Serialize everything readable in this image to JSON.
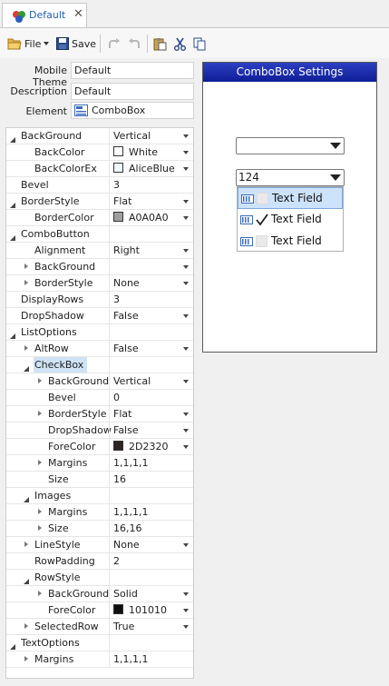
{
  "tab": {
    "label": "Default"
  },
  "toolbar": {
    "file_label": "File",
    "save_label": "Save"
  },
  "form": {
    "mobile_theme_label": "Mobile Theme",
    "mobile_theme_value": "Default",
    "description_label": "Description",
    "description_value": "Default",
    "element_label": "Element",
    "element_value": "ComboBox"
  },
  "grid": {
    "rows": [
      {
        "name": "BackGround",
        "value": "Vertical",
        "indent": 0,
        "toggle": "open",
        "dropdown": true
      },
      {
        "name": "BackColor",
        "value": "White",
        "indent": 1,
        "swatch": "#ffffff",
        "dropdown": true
      },
      {
        "name": "BackColorEx",
        "value": "AliceBlue",
        "indent": 1,
        "swatch": "#f0f8ff",
        "dropdown": true
      },
      {
        "name": "Bevel",
        "value": "3",
        "indent": 0
      },
      {
        "name": "BorderStyle",
        "value": "Flat",
        "indent": 0,
        "toggle": "open",
        "dropdown": true
      },
      {
        "name": "BorderColor",
        "value": "A0A0A0",
        "indent": 1,
        "swatch": "#a0a0a0",
        "dropdown": true
      },
      {
        "name": "ComboButton",
        "value": "",
        "indent": 0,
        "toggle": "open"
      },
      {
        "name": "Alignment",
        "value": "Right",
        "indent": 1,
        "dropdown": true
      },
      {
        "name": "BackGround",
        "value": "",
        "indent": 1,
        "toggle": "closed",
        "dropdown": true
      },
      {
        "name": "BorderStyle",
        "value": "None",
        "indent": 1,
        "toggle": "closed",
        "dropdown": true
      },
      {
        "name": "DisplayRows",
        "value": "3",
        "indent": 0
      },
      {
        "name": "DropShadow",
        "value": "False",
        "indent": 0,
        "dropdown": true
      },
      {
        "name": "ListOptions",
        "value": "",
        "indent": 0,
        "toggle": "open"
      },
      {
        "name": "AltRow",
        "value": "False",
        "indent": 1,
        "toggle": "closed",
        "dropdown": true
      },
      {
        "name": "CheckBox",
        "value": "",
        "indent": 1,
        "toggle": "open",
        "selected": true
      },
      {
        "name": "BackGround",
        "value": "Vertical",
        "indent": 2,
        "toggle": "closed",
        "dropdown": true
      },
      {
        "name": "Bevel",
        "value": "0",
        "indent": 2
      },
      {
        "name": "BorderStyle",
        "value": "Flat",
        "indent": 2,
        "toggle": "closed",
        "dropdown": true
      },
      {
        "name": "DropShadow",
        "value": "False",
        "indent": 2,
        "dropdown": true
      },
      {
        "name": "ForeColor",
        "value": "2D2320",
        "indent": 2,
        "swatch": "#2d2320",
        "dropdown": true
      },
      {
        "name": "Margins",
        "value": "1,1,1,1",
        "indent": 2,
        "toggle": "closed"
      },
      {
        "name": "Size",
        "value": "16",
        "indent": 2
      },
      {
        "name": "Images",
        "value": "",
        "indent": 1,
        "toggle": "open"
      },
      {
        "name": "Margins",
        "value": "1,1,1,1",
        "indent": 2,
        "toggle": "closed"
      },
      {
        "name": "Size",
        "value": "16,16",
        "indent": 2,
        "toggle": "closed"
      },
      {
        "name": "LineStyle",
        "value": "None",
        "indent": 1,
        "toggle": "closed",
        "dropdown": true
      },
      {
        "name": "RowPadding",
        "value": "2",
        "indent": 1
      },
      {
        "name": "RowStyle",
        "value": "",
        "indent": 1,
        "toggle": "open"
      },
      {
        "name": "BackGround",
        "value": "Solid",
        "indent": 2,
        "toggle": "closed",
        "dropdown": true
      },
      {
        "name": "ForeColor",
        "value": "101010",
        "indent": 2,
        "swatch": "#101010",
        "dropdown": true
      },
      {
        "name": "SelectedRow",
        "value": "True",
        "indent": 1,
        "toggle": "closed",
        "dropdown": true
      },
      {
        "name": "TextOptions",
        "value": "",
        "indent": 0,
        "toggle": "open"
      },
      {
        "name": "Margins",
        "value": "1,1,1,1",
        "indent": 1,
        "toggle": "closed"
      }
    ]
  },
  "preview": {
    "title": "ComboBox Settings",
    "combo1_value": "",
    "combo2_value": "124",
    "items": [
      {
        "label": "Text Field",
        "checked": false,
        "selected": true
      },
      {
        "label": "Text Field",
        "checked": true,
        "selected": false
      },
      {
        "label": "Text Field",
        "checked": false,
        "selected": false
      }
    ]
  },
  "colors": {
    "accent": "#1f5fb0",
    "title_bar": "#1a2bb0",
    "selection": "#cfe3f7"
  }
}
